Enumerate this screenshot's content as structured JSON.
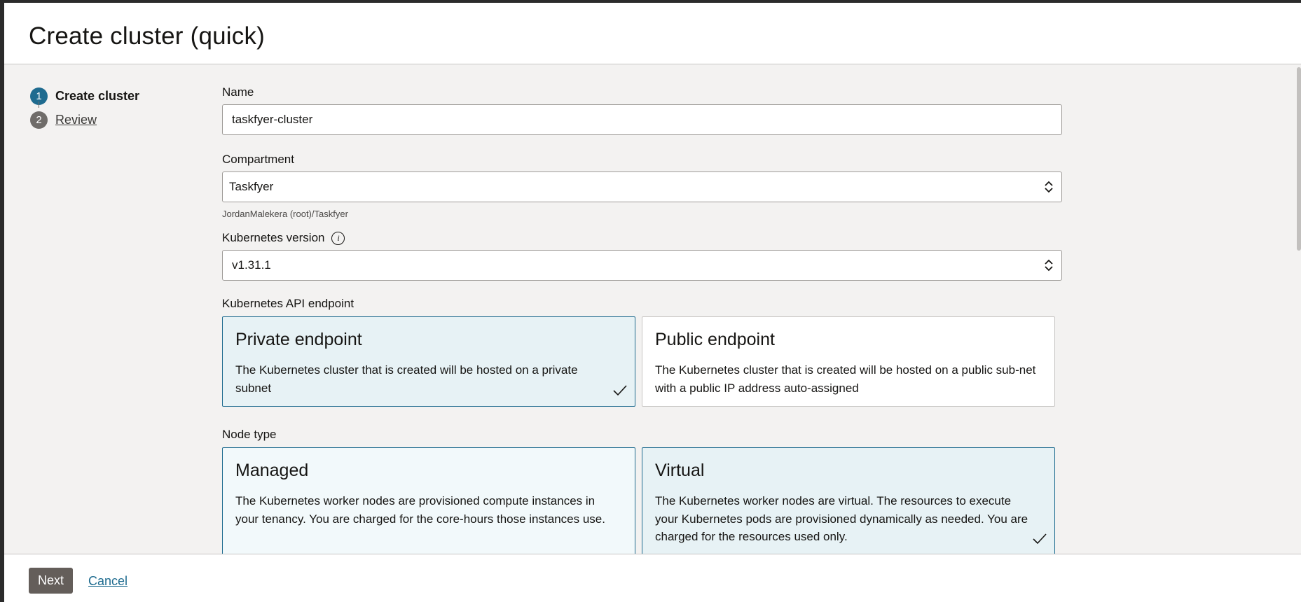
{
  "title": "Create cluster (quick)",
  "steps": [
    {
      "number": "1",
      "label": "Create cluster"
    },
    {
      "number": "2",
      "label": "Review"
    }
  ],
  "form": {
    "name": {
      "label": "Name",
      "value": "taskfyer-cluster"
    },
    "compartment": {
      "label": "Compartment",
      "value": "Taskfyer",
      "hint": "JordanMalekera (root)/Taskfyer"
    },
    "k8s_version": {
      "label": "Kubernetes version",
      "value": "v1.31.1"
    },
    "api_endpoint": {
      "label": "Kubernetes API endpoint",
      "options": [
        {
          "title": "Private endpoint",
          "desc": "The Kubernetes cluster that is created will be hosted on a private subnet",
          "selected": true
        },
        {
          "title": "Public endpoint",
          "desc": "The Kubernetes cluster that is created will be hosted on a public sub-net with a public IP address auto-assigned",
          "selected": false
        }
      ]
    },
    "node_type": {
      "label": "Node type",
      "options": [
        {
          "title": "Managed",
          "desc": "The Kubernetes worker nodes are provisioned compute instances in your tenancy. You are charged for the core-hours those instances use.",
          "selected": false
        },
        {
          "title": "Virtual",
          "desc": "The Kubernetes worker nodes are virtual. The resources to execute your Kubernetes pods are provisioned dynamically as needed. You are charged for the resources used only.",
          "selected": true
        }
      ]
    }
  },
  "footer": {
    "next_label": "Next",
    "cancel_label": "Cancel"
  },
  "colors": {
    "accent": "#1e6b8f",
    "selected_bg": "#e7f2f5",
    "button": "#645e5a"
  },
  "icons": {
    "info": "info-icon",
    "select": "chevron-updown-icon",
    "check": "check-icon"
  }
}
